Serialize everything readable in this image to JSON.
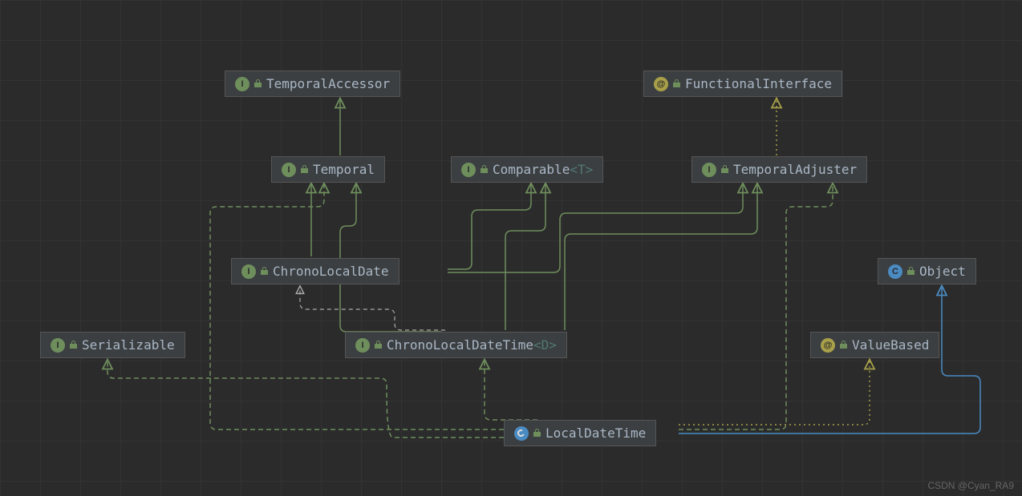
{
  "nodes": {
    "ta": {
      "label": "TemporalAccessor",
      "badge": "I"
    },
    "fi": {
      "label": "FunctionalInterface",
      "badge": "@"
    },
    "temporal": {
      "label": "Temporal",
      "badge": "I"
    },
    "comparable": {
      "label": "Comparable",
      "generic": "<T>",
      "badge": "I"
    },
    "tadj": {
      "label": "TemporalAdjuster",
      "badge": "I"
    },
    "cld": {
      "label": "ChronoLocalDate",
      "badge": "I"
    },
    "object": {
      "label": "Object",
      "badge": "C"
    },
    "serializable": {
      "label": "Serializable",
      "badge": "I"
    },
    "cldt": {
      "label": "ChronoLocalDateTime",
      "generic": "<D>",
      "badge": "I"
    },
    "valuebased": {
      "label": "ValueBased",
      "badge": "@"
    },
    "ldt": {
      "label": "LocalDateTime",
      "badge": "C"
    }
  },
  "legend_letters": {
    "interface": "I",
    "class": "C",
    "annotation": "@"
  },
  "watermark": "CSDN @Cyan_RA9"
}
